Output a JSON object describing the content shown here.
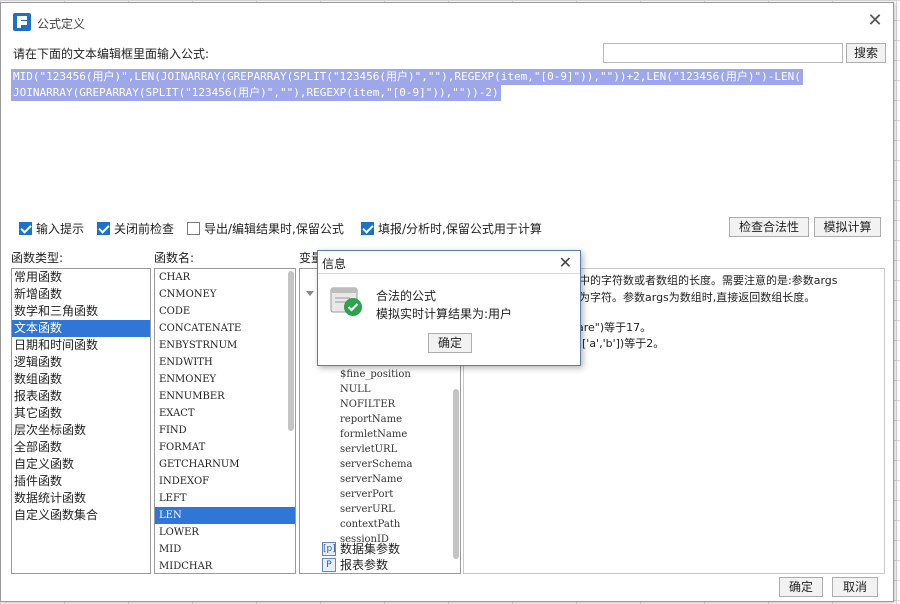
{
  "window": {
    "title": "公式定义"
  },
  "prompt": "请在下面的文本编辑框里面输入公式:",
  "search": {
    "value": "",
    "button": "搜索"
  },
  "formula": {
    "line1": "MID(\"123456(用户)\",LEN(JOINARRAY(GREPARRAY(SPLIT(\"123456(用户)\",\"\"),REGEXP(item,\"[0-9]\")),\"\"))+2,LEN(\"123456(用户)\")-LEN(",
    "line2": "JOINARRAY(GREPARRAY(SPLIT(\"123456(用户)\",\"\"),REGEXP(item,\"[0-9]\")),\"\"))-2)"
  },
  "options": [
    {
      "label": "输入提示",
      "checked": true
    },
    {
      "label": "关闭前检查",
      "checked": true
    },
    {
      "label": "导出/编辑结果时,保留公式",
      "checked": false
    },
    {
      "label": "填报/分析时,保留公式用于计算",
      "checked": true
    }
  ],
  "buttons": {
    "check": "检查合法性",
    "simulate": "模拟计算",
    "ok": "确定",
    "cancel": "取消"
  },
  "columns": {
    "category": "函数类型:",
    "function": "函数名:",
    "variable": "变量"
  },
  "categories": [
    "常用函数",
    "新增函数",
    "数学和三角函数",
    "文本函数",
    "日期和时间函数",
    "逻辑函数",
    "数组函数",
    "报表函数",
    "其它函数",
    "层次坐标函数",
    "全部函数",
    "自定义函数",
    "插件函数",
    "数据统计函数",
    "自定义函数集合"
  ],
  "selected_category": "文本函数",
  "functions": [
    "CHAR",
    "CNMONEY",
    "CODE",
    "CONCATENATE",
    "ENBYSTRNUM",
    "ENDWITH",
    "ENMONEY",
    "ENNUMBER",
    "EXACT",
    "FIND",
    "FORMAT",
    "GETCHARNUM",
    "INDEXOF",
    "LEFT",
    "LEN",
    "LOWER",
    "MID",
    "MIDCHAR"
  ],
  "selected_function": "LEN",
  "variables": [
    "$fine_position",
    "NULL",
    "NOFILTER",
    "reportName",
    "formletName",
    "servletURL",
    "serverSchema",
    "serverName",
    "serverPort",
    "serverURL",
    "contextPath",
    "sessionID"
  ],
  "tree_nodes": [
    {
      "label": "数据集参数",
      "icon": "[p]"
    },
    {
      "label": "报表参数",
      "icon": "P"
    }
  ],
  "description": {
    "line1": "串中的字符数或者数组的长度。需要注意的是:参数args",
    "line2": "计为字符。参数args为数组时,直接返回数组长度。",
    "line3": "are\")等于17。",
    "line4": "['a','b'])等于2。"
  },
  "popup": {
    "title": "信息",
    "message1": "合法的公式",
    "message2": "模拟实时计算结果为:用户",
    "ok": "确定"
  }
}
